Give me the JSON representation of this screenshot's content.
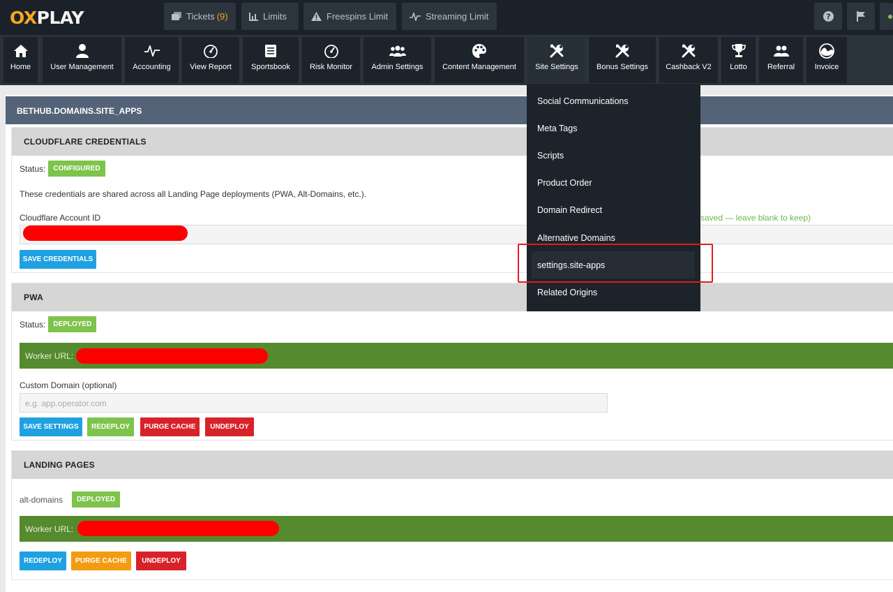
{
  "header": {
    "logo_part1": "OX",
    "logo_part2": "PLAY",
    "buttons": [
      {
        "label": "Tickets",
        "count": "(9)",
        "icon": "ticket-icon"
      },
      {
        "label": "Limits",
        "icon": "bars-icon"
      },
      {
        "label": "Freespins Limit",
        "icon": "warning-icon"
      },
      {
        "label": "Streaming Limit",
        "icon": "pulse-icon"
      }
    ],
    "icon_buttons": [
      "help-icon",
      "flag-icon"
    ]
  },
  "nav": {
    "items": [
      {
        "label": "Home",
        "icon": "home-icon"
      },
      {
        "label": "User Management",
        "icon": "user-icon"
      },
      {
        "label": "Accounting",
        "icon": "pulse-icon"
      },
      {
        "label": "View Report",
        "icon": "gauge-icon"
      },
      {
        "label": "Sportsbook",
        "icon": "document-icon"
      },
      {
        "label": "Risk Monitor",
        "icon": "gauge-icon"
      },
      {
        "label": "Admin Settings",
        "icon": "users-icon"
      },
      {
        "label": "Content Management",
        "icon": "palette-icon"
      },
      {
        "label": "Site Settings",
        "icon": "tools-icon"
      },
      {
        "label": "Bonus Settings",
        "icon": "tools-icon"
      },
      {
        "label": "Cashback V2",
        "icon": "tools-icon"
      },
      {
        "label": "Lotto",
        "icon": "trophy-icon"
      },
      {
        "label": "Referral",
        "icon": "users-icon"
      },
      {
        "label": "Invoice",
        "icon": "wave-icon"
      }
    ],
    "active": "Site Settings"
  },
  "dropdown": {
    "items": [
      "Social Communications",
      "Meta Tags",
      "Scripts",
      "Product Order",
      "Domain Redirect",
      "Alternative Domains",
      "settings.site-apps",
      "Related Origins"
    ],
    "selected": "settings.site-apps"
  },
  "page": {
    "title": "BETHUB.DOMAINS.SITE_APPS"
  },
  "cloudflare": {
    "title": "CLOUDFLARE CREDENTIALS",
    "status_label": "Status:",
    "status": "CONFIGURED",
    "note": "These credentials are shared across all Landing Page deployments (PWA, Alt-Domains, etc.).",
    "account_id_label": "Cloudflare Account ID",
    "token_hint": "saved — leave blank to keep)",
    "save_button": "SAVE CREDENTIALS"
  },
  "pwa": {
    "title": "PWA",
    "status_label": "Status:",
    "status": "DEPLOYED",
    "worker_label": "Worker URL:",
    "custom_domain_label": "Custom Domain (optional)",
    "custom_domain_placeholder": "e.g. app.operator.com",
    "buttons": {
      "save": "SAVE SETTINGS",
      "redeploy": "REDEPLOY",
      "purge": "PURGE CACHE",
      "undeploy": "UNDEPLOY"
    }
  },
  "landing": {
    "title": "LANDING PAGES",
    "item_name": "alt-domains",
    "status": "DEPLOYED",
    "worker_label": "Worker URL:",
    "buttons": {
      "redeploy": "REDEPLOY",
      "purge": "PURGE CACHE",
      "undeploy": "UNDEPLOY"
    }
  },
  "colors": {
    "header_bg": "#1b2128",
    "nav_bg": "#2b333c",
    "accent_orange": "#f5a623",
    "green": "#7ec34b",
    "dark_green": "#568a2e",
    "blue": "#1fa1e1",
    "red": "#d8222a",
    "orange": "#f39c12",
    "highlight_box": "#e31b23"
  }
}
